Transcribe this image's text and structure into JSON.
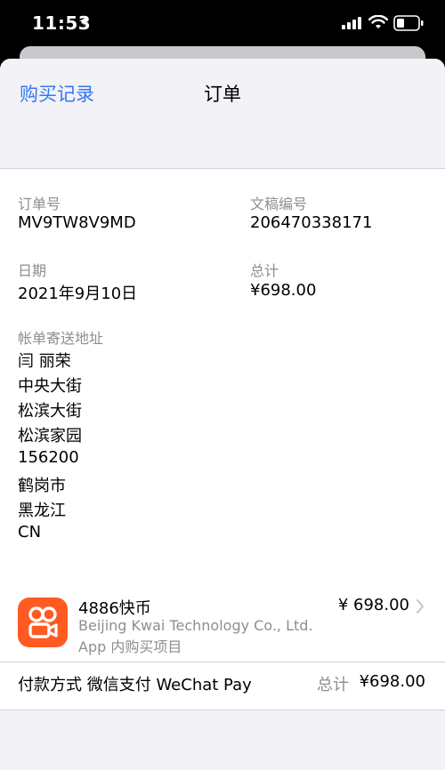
{
  "status_bar": {
    "time": "11:53"
  },
  "nav": {
    "back_label": "购买记录",
    "title": "订单"
  },
  "order": {
    "order_no_label": "订单号",
    "order_no": "MV9TW8V9MD",
    "doc_no_label": "文稿编号",
    "doc_no": "206470338171",
    "date_label": "日期",
    "date": "2021年9月10日",
    "total_label": "总计",
    "total": "¥698.00",
    "billing_label": "帐单寄送地址",
    "billing_lines": [
      "闫 丽荣",
      "中央大街",
      "松滨大街",
      "松滨家园",
      "156200",
      "鹤岗市",
      "黑龙江",
      "CN"
    ]
  },
  "purchase": {
    "icon": "kuaishou-app-icon",
    "icon_color": "#fe5a21",
    "item_name": "4886快币",
    "seller": "Beijing Kwai Technology Co., Ltd.",
    "type": "App 内购买项目",
    "price": "¥ 698.00"
  },
  "payment": {
    "method": "付款方式 微信支付 WeChat Pay",
    "total_label": "总计",
    "total": "¥698.00"
  },
  "colors": {
    "link": "#3478f6",
    "secondary_text": "#8e8e93",
    "background": "#f2f2f7"
  }
}
